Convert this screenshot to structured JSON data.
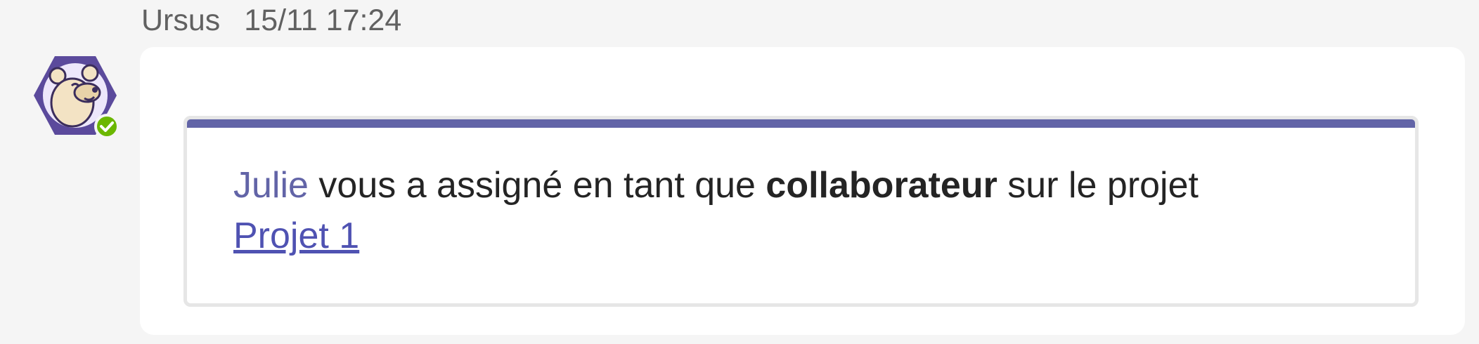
{
  "message": {
    "author": "Ursus",
    "timestamp": "15/11 17:24",
    "avatar": {
      "icon": "bear-bot-avatar",
      "hex_color": "#5b4a9c",
      "bear_color": "#f3e3c4",
      "presence": "available",
      "presence_color": "#6bb700"
    },
    "card": {
      "accent_color": "#6264a7",
      "mention": "Julie",
      "text_1": "vous a assigné en tant que",
      "role": "collaborateur",
      "text_2": "sur le projet",
      "project_link": "Projet 1"
    }
  }
}
